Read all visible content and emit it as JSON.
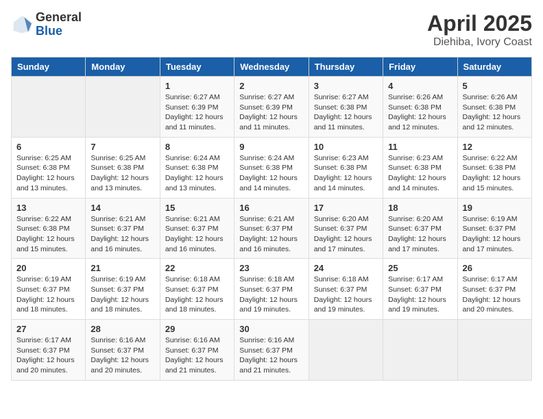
{
  "logo": {
    "general": "General",
    "blue": "Blue"
  },
  "title": "April 2025",
  "subtitle": "Diehiba, Ivory Coast",
  "weekdays": [
    "Sunday",
    "Monday",
    "Tuesday",
    "Wednesday",
    "Thursday",
    "Friday",
    "Saturday"
  ],
  "weeks": [
    [
      {
        "day": "",
        "info": ""
      },
      {
        "day": "",
        "info": ""
      },
      {
        "day": "1",
        "info": "Sunrise: 6:27 AM\nSunset: 6:39 PM\nDaylight: 12 hours and 11 minutes."
      },
      {
        "day": "2",
        "info": "Sunrise: 6:27 AM\nSunset: 6:39 PM\nDaylight: 12 hours and 11 minutes."
      },
      {
        "day": "3",
        "info": "Sunrise: 6:27 AM\nSunset: 6:38 PM\nDaylight: 12 hours and 11 minutes."
      },
      {
        "day": "4",
        "info": "Sunrise: 6:26 AM\nSunset: 6:38 PM\nDaylight: 12 hours and 12 minutes."
      },
      {
        "day": "5",
        "info": "Sunrise: 6:26 AM\nSunset: 6:38 PM\nDaylight: 12 hours and 12 minutes."
      }
    ],
    [
      {
        "day": "6",
        "info": "Sunrise: 6:25 AM\nSunset: 6:38 PM\nDaylight: 12 hours and 13 minutes."
      },
      {
        "day": "7",
        "info": "Sunrise: 6:25 AM\nSunset: 6:38 PM\nDaylight: 12 hours and 13 minutes."
      },
      {
        "day": "8",
        "info": "Sunrise: 6:24 AM\nSunset: 6:38 PM\nDaylight: 12 hours and 13 minutes."
      },
      {
        "day": "9",
        "info": "Sunrise: 6:24 AM\nSunset: 6:38 PM\nDaylight: 12 hours and 14 minutes."
      },
      {
        "day": "10",
        "info": "Sunrise: 6:23 AM\nSunset: 6:38 PM\nDaylight: 12 hours and 14 minutes."
      },
      {
        "day": "11",
        "info": "Sunrise: 6:23 AM\nSunset: 6:38 PM\nDaylight: 12 hours and 14 minutes."
      },
      {
        "day": "12",
        "info": "Sunrise: 6:22 AM\nSunset: 6:38 PM\nDaylight: 12 hours and 15 minutes."
      }
    ],
    [
      {
        "day": "13",
        "info": "Sunrise: 6:22 AM\nSunset: 6:38 PM\nDaylight: 12 hours and 15 minutes."
      },
      {
        "day": "14",
        "info": "Sunrise: 6:21 AM\nSunset: 6:37 PM\nDaylight: 12 hours and 16 minutes."
      },
      {
        "day": "15",
        "info": "Sunrise: 6:21 AM\nSunset: 6:37 PM\nDaylight: 12 hours and 16 minutes."
      },
      {
        "day": "16",
        "info": "Sunrise: 6:21 AM\nSunset: 6:37 PM\nDaylight: 12 hours and 16 minutes."
      },
      {
        "day": "17",
        "info": "Sunrise: 6:20 AM\nSunset: 6:37 PM\nDaylight: 12 hours and 17 minutes."
      },
      {
        "day": "18",
        "info": "Sunrise: 6:20 AM\nSunset: 6:37 PM\nDaylight: 12 hours and 17 minutes."
      },
      {
        "day": "19",
        "info": "Sunrise: 6:19 AM\nSunset: 6:37 PM\nDaylight: 12 hours and 17 minutes."
      }
    ],
    [
      {
        "day": "20",
        "info": "Sunrise: 6:19 AM\nSunset: 6:37 PM\nDaylight: 12 hours and 18 minutes."
      },
      {
        "day": "21",
        "info": "Sunrise: 6:19 AM\nSunset: 6:37 PM\nDaylight: 12 hours and 18 minutes."
      },
      {
        "day": "22",
        "info": "Sunrise: 6:18 AM\nSunset: 6:37 PM\nDaylight: 12 hours and 18 minutes."
      },
      {
        "day": "23",
        "info": "Sunrise: 6:18 AM\nSunset: 6:37 PM\nDaylight: 12 hours and 19 minutes."
      },
      {
        "day": "24",
        "info": "Sunrise: 6:18 AM\nSunset: 6:37 PM\nDaylight: 12 hours and 19 minutes."
      },
      {
        "day": "25",
        "info": "Sunrise: 6:17 AM\nSunset: 6:37 PM\nDaylight: 12 hours and 19 minutes."
      },
      {
        "day": "26",
        "info": "Sunrise: 6:17 AM\nSunset: 6:37 PM\nDaylight: 12 hours and 20 minutes."
      }
    ],
    [
      {
        "day": "27",
        "info": "Sunrise: 6:17 AM\nSunset: 6:37 PM\nDaylight: 12 hours and 20 minutes."
      },
      {
        "day": "28",
        "info": "Sunrise: 6:16 AM\nSunset: 6:37 PM\nDaylight: 12 hours and 20 minutes."
      },
      {
        "day": "29",
        "info": "Sunrise: 6:16 AM\nSunset: 6:37 PM\nDaylight: 12 hours and 21 minutes."
      },
      {
        "day": "30",
        "info": "Sunrise: 6:16 AM\nSunset: 6:37 PM\nDaylight: 12 hours and 21 minutes."
      },
      {
        "day": "",
        "info": ""
      },
      {
        "day": "",
        "info": ""
      },
      {
        "day": "",
        "info": ""
      }
    ]
  ]
}
